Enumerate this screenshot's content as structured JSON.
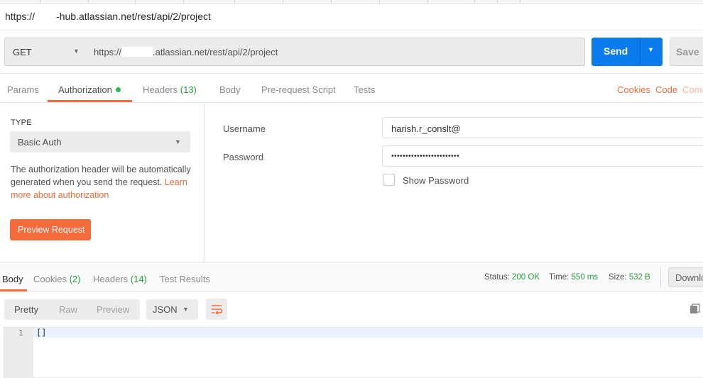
{
  "titlebar": {
    "title_prefix": "https://",
    "title_suffix": "-hub.atlassian.net/rest/api/2/project"
  },
  "request": {
    "method": "GET",
    "url_prefix": "https://",
    "url_suffix": ".atlassian.net/rest/api/2/project",
    "send_label": "Send",
    "save_label": "Save"
  },
  "request_tabs": {
    "params": "Params",
    "authorization": "Authorization",
    "headers": "Headers",
    "headers_count": "(13)",
    "body": "Body",
    "prerequest": "Pre-request Script",
    "tests": "Tests",
    "cookies": "Cookies",
    "code": "Code",
    "comments": "Comm"
  },
  "auth": {
    "type_label": "TYPE",
    "type_value": "Basic Auth",
    "help_text": "The authorization header will be automatically generated when you send the request.",
    "help_link": "Learn more about authorization",
    "preview_label": "Preview Request",
    "username_label": "Username",
    "username_value": "harish.r_conslt@",
    "password_label": "Password",
    "password_value": "••••••••••••••••••••••••",
    "show_password_label": "Show Password",
    "show_password_checked": false
  },
  "response_tabs": {
    "body": "Body",
    "cookies": "Cookies",
    "cookies_count": "(2)",
    "headers": "Headers",
    "headers_count": "(14)",
    "test_results": "Test Results"
  },
  "status": {
    "status_label": "Status:",
    "status_value": "200 OK",
    "time_label": "Time:",
    "time_value": "550 ms",
    "size_label": "Size:",
    "size_value": "532 B",
    "download_label": "Downlo"
  },
  "viewer": {
    "pretty": "Pretty",
    "raw": "Raw",
    "preview": "Preview",
    "format": "JSON",
    "line_number": "1",
    "content": "[]"
  },
  "icons": {
    "wrap": "wrap-lines-icon",
    "copy": "copy-icon"
  },
  "colors": {
    "accent_orange": "#f26b3a",
    "send_blue": "#097bed",
    "success_green": "#2a9d3c"
  }
}
